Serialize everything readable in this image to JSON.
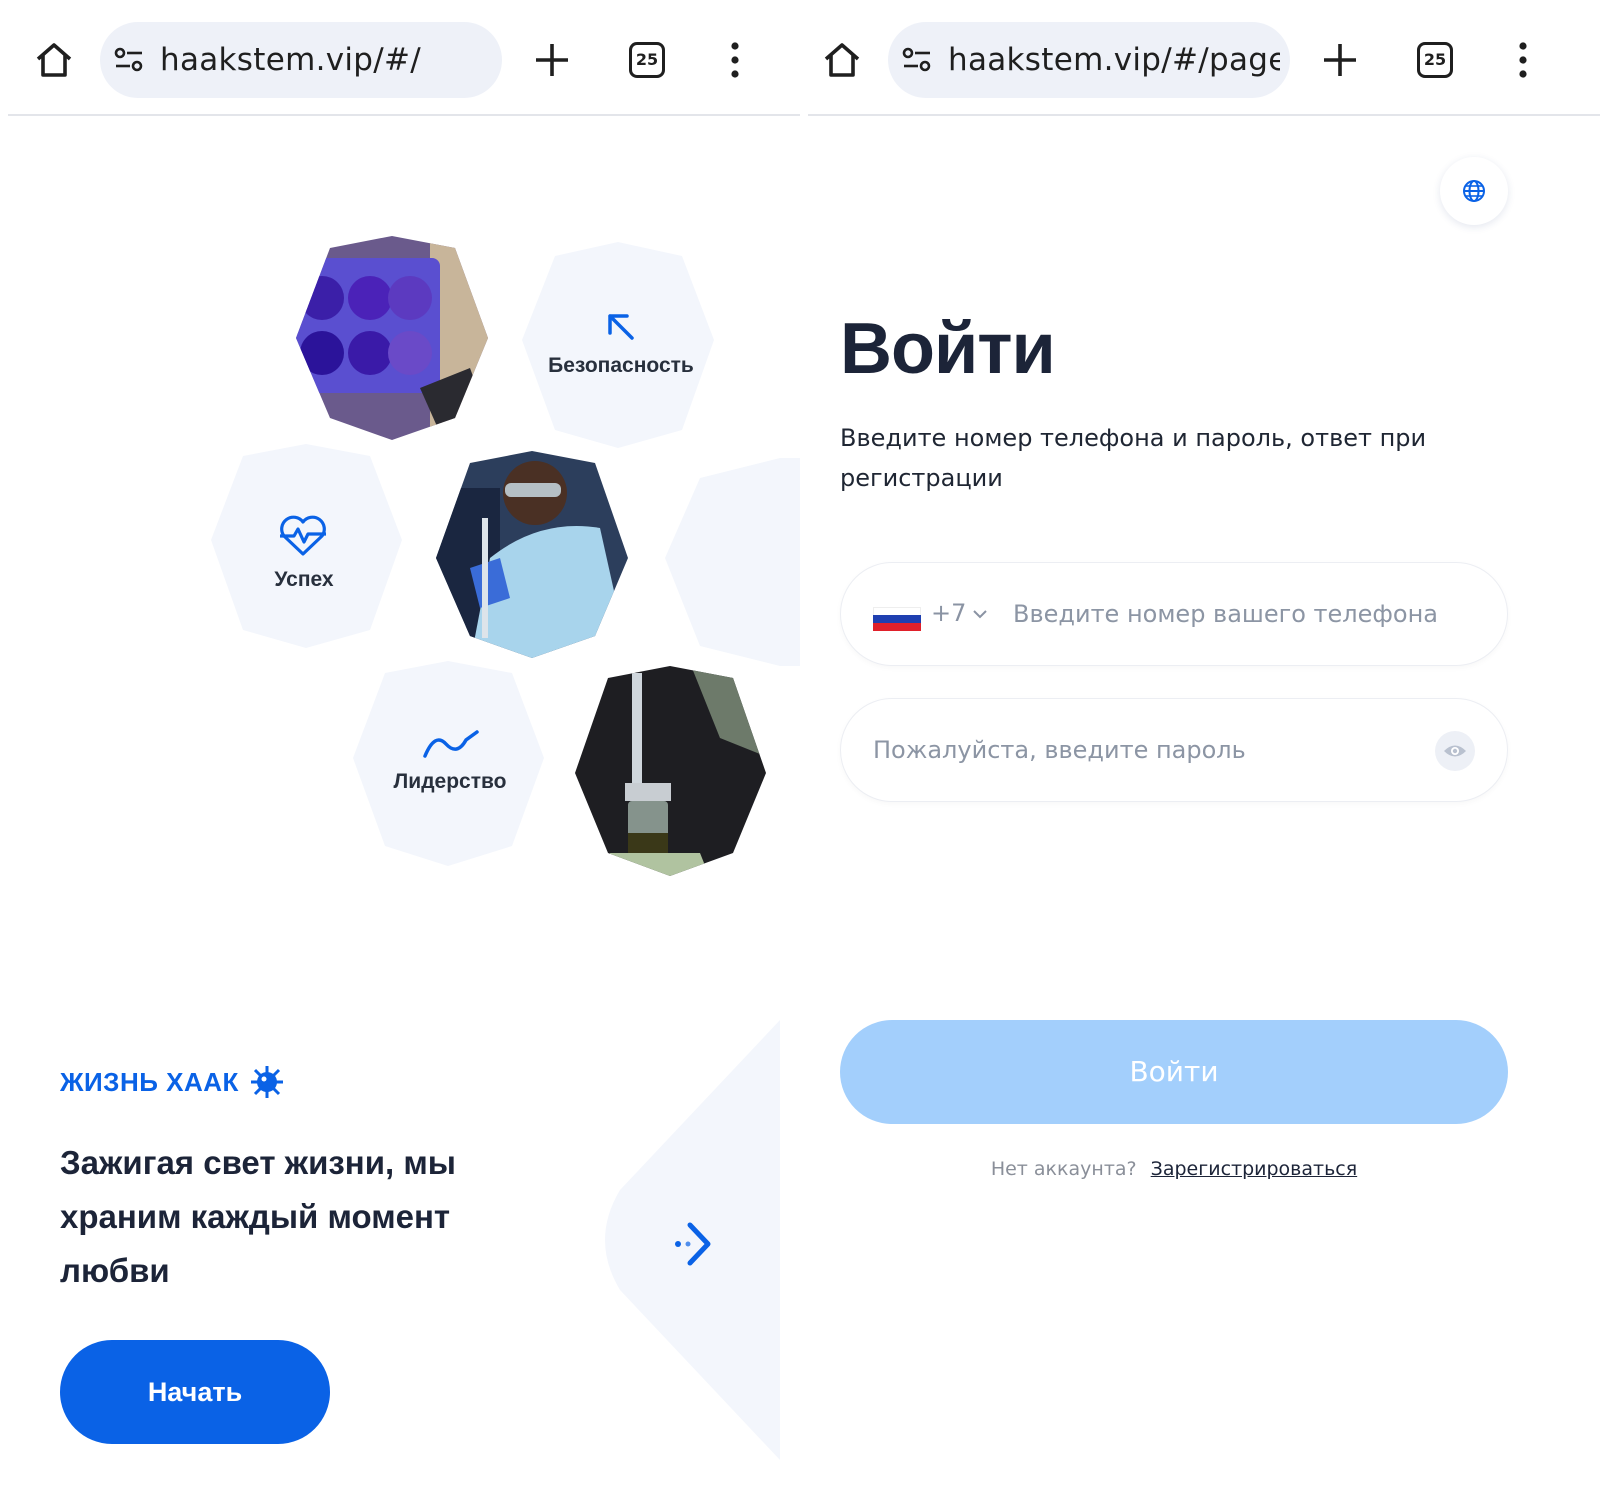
{
  "left": {
    "chrome": {
      "url": "haakstem.vip/#/",
      "tab_count": "25"
    },
    "hex_labels": {
      "security": "Безопасность",
      "success": "Успех",
      "leadership": "Лидерство"
    },
    "brand": "ЖИЗНЬ ХААК",
    "tagline": "Зажигая свет жизни, мы храним каждый момент любви",
    "start_button": "Начать"
  },
  "right": {
    "chrome": {
      "url": "haakstem.vip/#/pages/",
      "tab_count": "25"
    },
    "title": "Войти",
    "subtitle": "Введите номер телефона и пароль, ответ при регистрации",
    "phone": {
      "country_code": "+7",
      "placeholder": "Введите номер вашего телефона",
      "value": ""
    },
    "password": {
      "placeholder": "Пожалуйста, введите пароль",
      "value": ""
    },
    "submit_button": "Войти",
    "register_question": "Нет аккаунта?",
    "register_link": "Зарегистрироваться"
  },
  "colors": {
    "accent": "#0a62e6",
    "accent_light": "#a3cffc",
    "hex_bg": "#f3f6fc",
    "title": "#1c2438"
  },
  "icons": [
    "home-icon",
    "site-settings-icon",
    "new-tab-icon",
    "tab-switcher-icon",
    "menu-icon",
    "globe-icon",
    "arrow-up-left-icon",
    "heartbeat-icon",
    "wave-icon",
    "virus-icon",
    "chevron-right-icon",
    "eye-icon",
    "chevron-down-icon"
  ]
}
